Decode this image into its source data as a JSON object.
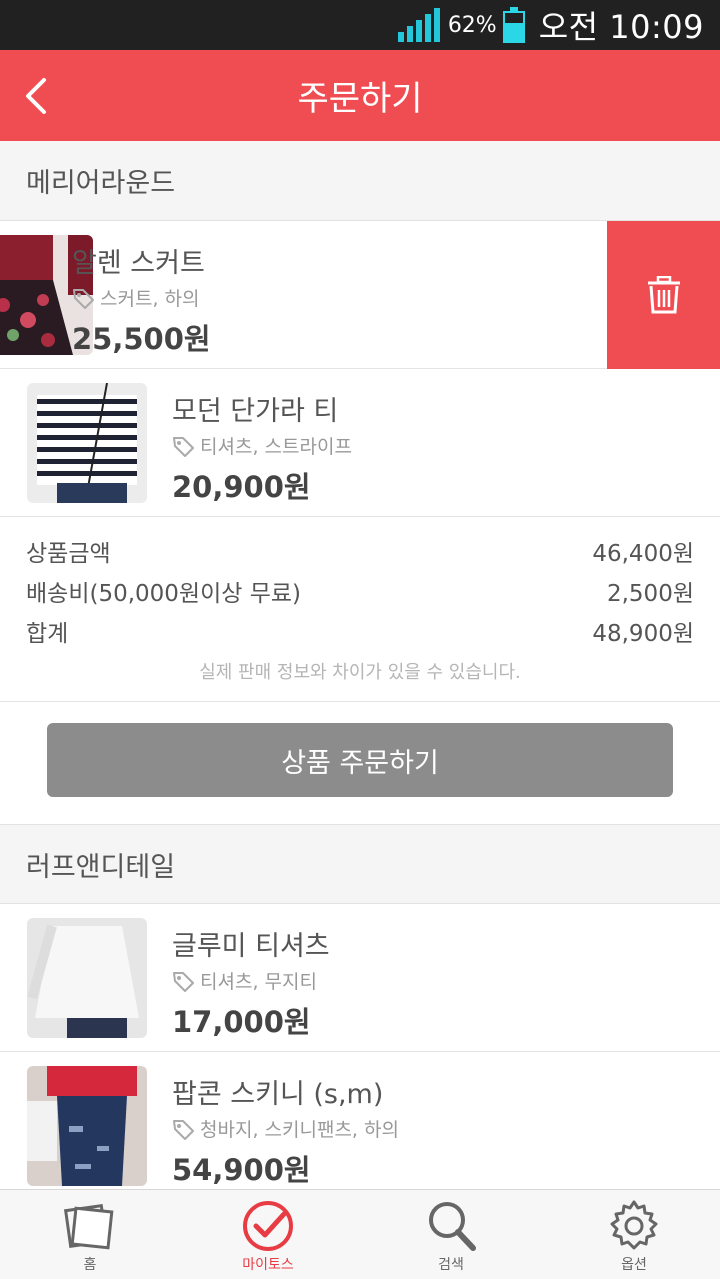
{
  "status_bar": {
    "battery_percent": "62%",
    "time": "오전 10:09"
  },
  "header": {
    "title": "주문하기",
    "back_icon": "chevron-left-icon"
  },
  "shops": [
    {
      "name": "메리어라운드",
      "products": [
        {
          "name": "알렌 스커트",
          "tags": "스커트, 하의",
          "price": "25,500원",
          "swiped_delete": true
        },
        {
          "name": "모던 단가라 티",
          "tags": "티셔츠, 스트라이프",
          "price": "20,900원"
        }
      ],
      "summary": {
        "rows": [
          {
            "label": "상품금액",
            "value": "46,400원"
          },
          {
            "label": "배송비(50,000원이상 무료)",
            "value": "2,500원"
          },
          {
            "label": "합계",
            "value": "48,900원"
          }
        ],
        "notice": "실제 판매 정보와 차이가 있을 수 있습니다."
      },
      "order_button": "상품 주문하기"
    },
    {
      "name": "러프앤디테일",
      "products": [
        {
          "name": "글루미 티셔츠",
          "tags": "티셔츠, 무지티",
          "price": "17,000원"
        },
        {
          "name": "팝콘 스키니 (s,m)",
          "tags": "청바지, 스키니팬츠, 하의",
          "price": "54,900원"
        }
      ]
    }
  ],
  "bottom_nav": [
    {
      "label": "홈",
      "icon": "home-stack-icon",
      "active": false
    },
    {
      "label": "마이토스",
      "icon": "check-circle-icon",
      "active": true
    },
    {
      "label": "검색",
      "icon": "search-icon",
      "active": false
    },
    {
      "label": "옵션",
      "icon": "gear-icon",
      "active": false
    }
  ],
  "colors": {
    "accent": "#f04d52",
    "status_bar": "#212121",
    "order_button": "#8c8c8c"
  }
}
